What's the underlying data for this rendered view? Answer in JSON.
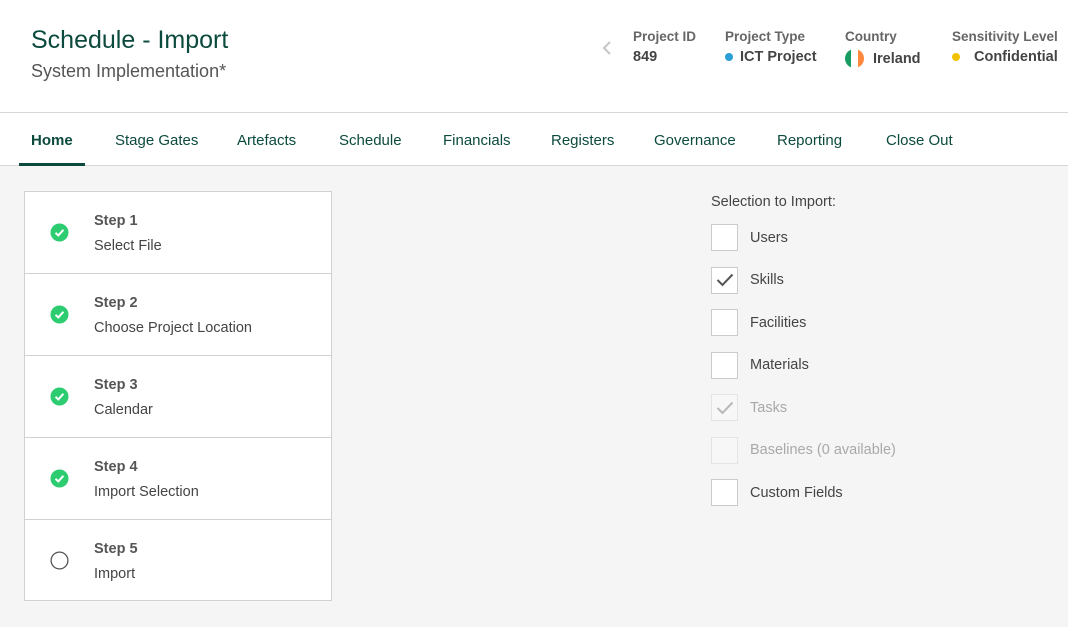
{
  "header": {
    "title": "Schedule - Import",
    "subtitle": "System Implementation*",
    "back_icon": "chevron-left-icon",
    "meta": [
      {
        "label": "Project ID",
        "value": "849"
      },
      {
        "label": "Project Type",
        "value": "ICT Project",
        "dot_color": "#2a9fd6"
      },
      {
        "label": "Country",
        "value": "Ireland",
        "icon": "ireland-flag-icon"
      },
      {
        "label": "Sensitivity Level",
        "value": "Confidential",
        "dot_color": "#f2c200"
      }
    ]
  },
  "nav": {
    "active": "Home",
    "tabs": [
      "Home",
      "Stage Gates",
      "Artefacts",
      "Schedule",
      "Financials",
      "Registers",
      "Governance",
      "Reporting",
      "Close Out"
    ]
  },
  "steps": [
    {
      "name": "Step 1",
      "desc": "Select File",
      "status": "complete"
    },
    {
      "name": "Step 2",
      "desc": "Choose Project Location",
      "status": "complete"
    },
    {
      "name": "Step 3",
      "desc": "Calendar",
      "status": "complete"
    },
    {
      "name": "Step 4",
      "desc": "Import Selection",
      "status": "complete"
    },
    {
      "name": "Step 5",
      "desc": "Import",
      "status": "pending"
    }
  ],
  "selection": {
    "label": "Selection to Import:",
    "options": [
      {
        "label": "Users",
        "checked": false,
        "disabled": false
      },
      {
        "label": "Skills",
        "checked": true,
        "disabled": false
      },
      {
        "label": "Facilities",
        "checked": false,
        "disabled": false
      },
      {
        "label": "Materials",
        "checked": false,
        "disabled": false
      },
      {
        "label": "Tasks",
        "checked": true,
        "disabled": true
      },
      {
        "label": "Baselines (0 available)",
        "checked": false,
        "disabled": true
      },
      {
        "label": "Custom Fields",
        "checked": false,
        "disabled": false
      }
    ]
  },
  "colors": {
    "brand": "#0c4a3e",
    "complete": "#2ecc71",
    "flag": [
      "#169b62",
      "#ffffff",
      "#ff883e"
    ]
  }
}
